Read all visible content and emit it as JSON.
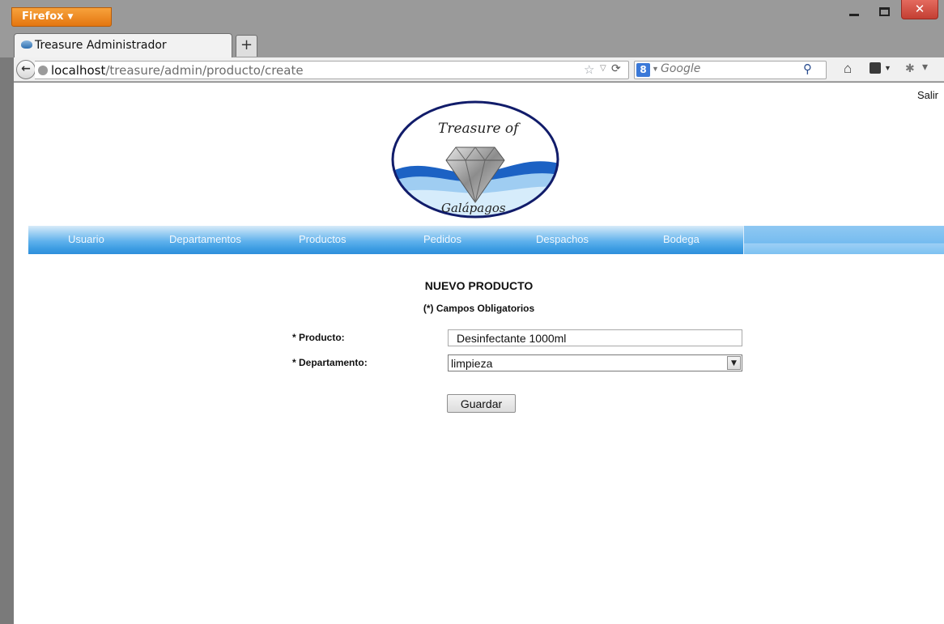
{
  "browser": {
    "app_button": "Firefox",
    "tab_title": "Treasure Administrador",
    "new_tab": "+",
    "url_host": "localhost",
    "url_path": "/treasure/admin/producto/create",
    "search_placeholder": "Google",
    "search_engine_icon": "8"
  },
  "page": {
    "logout_label": "Salir",
    "logo": {
      "top_script": "Treasure of",
      "bottom_script": "Galápagos"
    },
    "menu": [
      "Usuario",
      "Departamentos",
      "Productos",
      "Pedidos",
      "Despachos",
      "Bodega"
    ],
    "form": {
      "title": "NUEVO PRODUCTO",
      "note": "(*) Campos Obligatorios",
      "producto_label": "* Producto:",
      "producto_value": "Desinfectante 1000ml",
      "departamento_label": "* Departamento:",
      "departamento_value": "limpieza",
      "submit_label": "Guardar"
    }
  },
  "colors": {
    "firefox_orange": "#e47610",
    "menu_blue": "#3d9de3",
    "close_red": "#c33f33"
  }
}
